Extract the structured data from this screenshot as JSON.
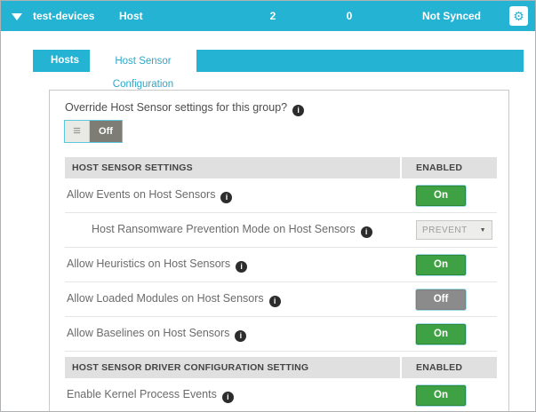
{
  "topbar": {
    "group_name": "test-devices",
    "type_label": "Host",
    "counts": [
      "2",
      "0"
    ],
    "sync_status": "Not Synced"
  },
  "tabs": [
    {
      "label": "Hosts",
      "active": false
    },
    {
      "label": "Host Sensor Configuration",
      "active": true
    }
  ],
  "panel": {
    "override_question": "Override Host Sensor settings for this group?",
    "override_toggle_value": "Off",
    "sections": [
      {
        "header": "HOST SENSOR SETTINGS",
        "enabled_header": "ENABLED",
        "rows": [
          {
            "label": "Allow Events on Host Sensors",
            "control": "toggle",
            "value": "On",
            "indent": false
          },
          {
            "label": "Host Ransomware Prevention Mode on Host Sensors",
            "control": "select",
            "value": "PREVENT",
            "indent": true
          },
          {
            "label": "Allow Heuristics on Host Sensors",
            "control": "toggle",
            "value": "On",
            "indent": false
          },
          {
            "label": "Allow Loaded Modules on Host Sensors",
            "control": "toggle",
            "value": "Off",
            "indent": false
          },
          {
            "label": "Allow Baselines on Host Sensors",
            "control": "toggle",
            "value": "On",
            "indent": false
          }
        ]
      },
      {
        "header": "HOST SENSOR DRIVER CONFIGURATION SETTING",
        "enabled_header": "ENABLED",
        "rows": [
          {
            "label": "Enable Kernel Process Events",
            "control": "toggle",
            "value": "On",
            "indent": false
          }
        ]
      }
    ]
  },
  "icons": {
    "info": "i",
    "gear": "⚙",
    "menu": "≡",
    "select_caret": "▼"
  },
  "colors": {
    "teal": "#25b3d4",
    "tab_active_text": "#2ea7c9",
    "green_on": "#3ea144",
    "gray_off": "#8b8b8b",
    "header_bg": "#e0e0e0",
    "label_text": "#6b6b6b"
  }
}
